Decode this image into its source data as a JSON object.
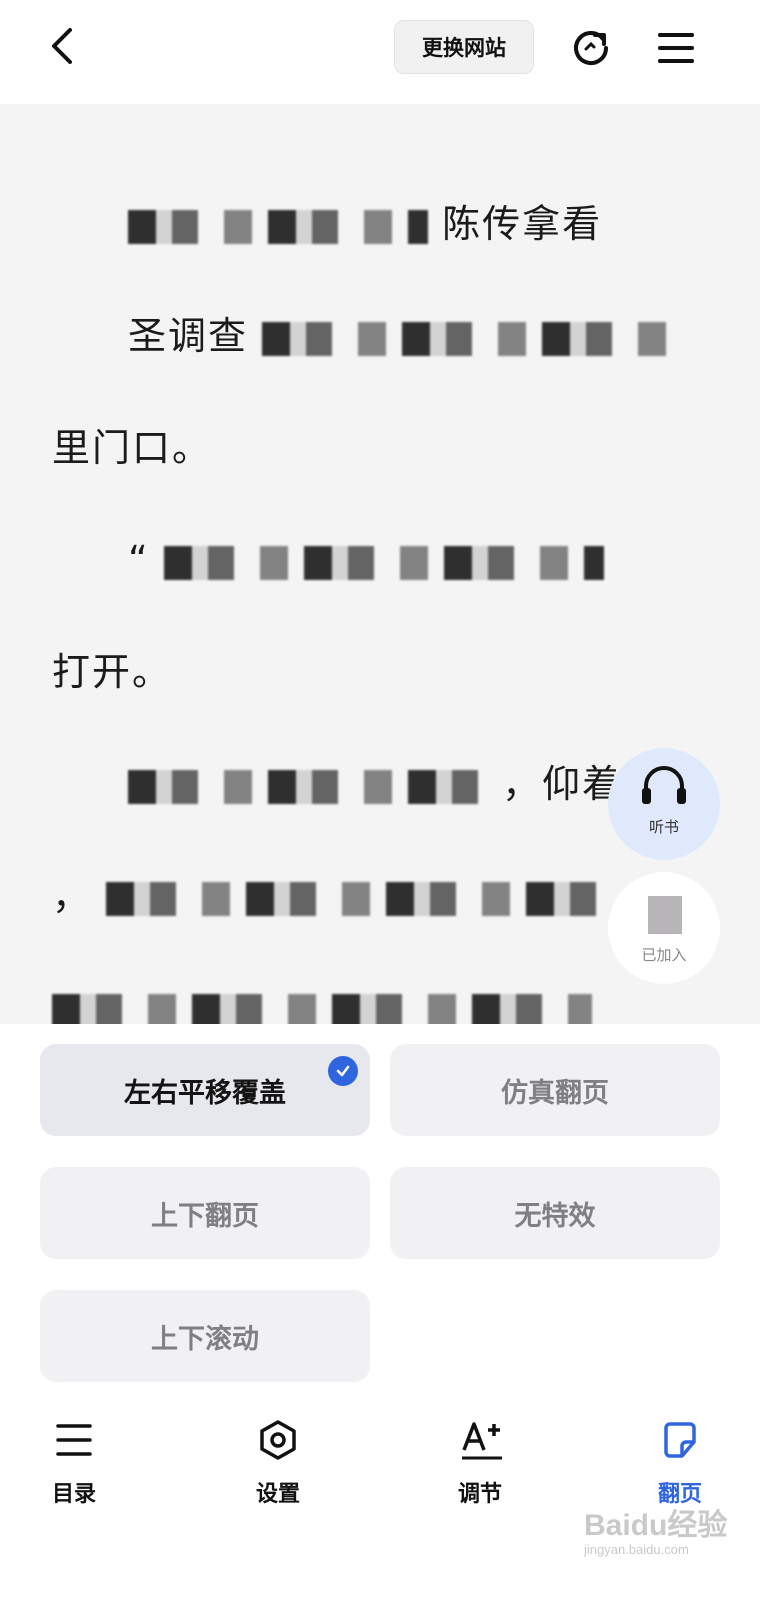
{
  "header": {
    "switch_site_label": "更换网站"
  },
  "reader": {
    "line_fragments": [
      "陈传拿看",
      "圣调查",
      "里门口。",
      "“",
      "打开。",
      "，仰着头",
      "，",
      "看到"
    ]
  },
  "floating": {
    "listen_label": "听书",
    "added_label": "已加入"
  },
  "page_turn": {
    "options": [
      {
        "label": "左右平移覆盖",
        "selected": true
      },
      {
        "label": "仿真翻页",
        "selected": false
      },
      {
        "label": "上下翻页",
        "selected": false
      },
      {
        "label": "无特效",
        "selected": false
      },
      {
        "label": "上下滚动",
        "selected": false
      }
    ]
  },
  "bottom_nav": {
    "items": [
      {
        "label": "目录",
        "icon": "list-icon"
      },
      {
        "label": "设置",
        "icon": "settings-hex-icon"
      },
      {
        "label": "调节",
        "icon": "font-adjust-icon"
      },
      {
        "label": "翻页",
        "icon": "page-turn-icon",
        "active": true
      }
    ]
  },
  "watermark": {
    "brand": "Baidu经验",
    "url": "jingyan.baidu.com"
  },
  "colors": {
    "accent": "#2f66e0",
    "reader_bg": "#f4f4f5",
    "option_bg": "#f1f1f4"
  }
}
